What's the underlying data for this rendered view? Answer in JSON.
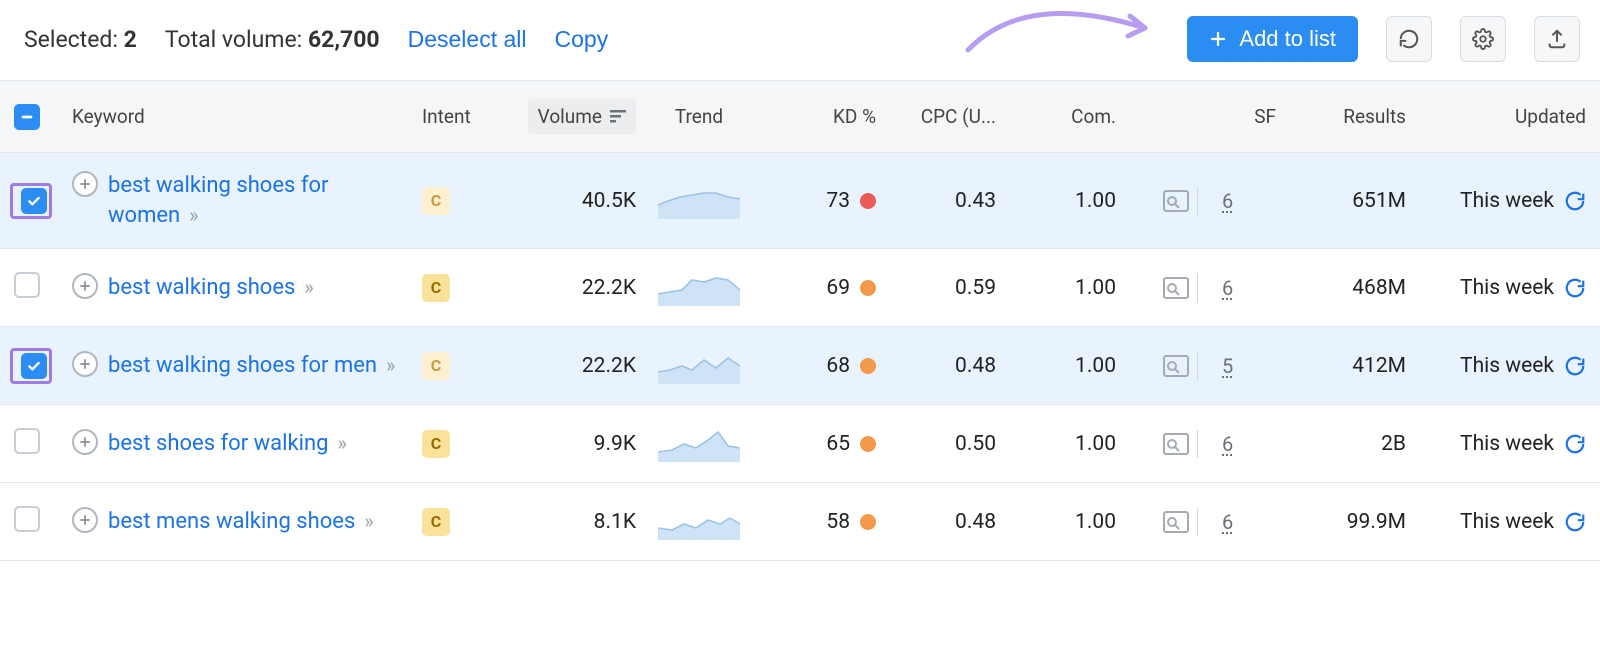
{
  "topbar": {
    "selected_label": "Selected:",
    "selected_count": "2",
    "total_volume_label": "Total volume:",
    "total_volume_value": "62,700",
    "deselect_all": "Deselect all",
    "copy": "Copy",
    "add_to_list": "Add to list"
  },
  "columns": {
    "keyword": "Keyword",
    "intent": "Intent",
    "volume": "Volume",
    "trend": "Trend",
    "kd": "KD %",
    "cpc": "CPC (U...",
    "com": "Com.",
    "sf": "SF",
    "results": "Results",
    "updated": "Updated"
  },
  "rows": [
    {
      "selected": true,
      "highlight": true,
      "keyword": "best walking shoes for women",
      "intent": "C",
      "intent_faded": true,
      "volume": "40.5K",
      "kd": "73",
      "kd_color": "red",
      "cpc": "0.43",
      "com": "1.00",
      "sf": "6",
      "results": "651M",
      "updated": "This week"
    },
    {
      "selected": false,
      "highlight": false,
      "keyword": "best walking shoes",
      "intent": "C",
      "intent_faded": false,
      "volume": "22.2K",
      "kd": "69",
      "kd_color": "orange",
      "cpc": "0.59",
      "com": "1.00",
      "sf": "6",
      "results": "468M",
      "updated": "This week"
    },
    {
      "selected": true,
      "highlight": true,
      "keyword": "best walking shoes for men",
      "intent": "C",
      "intent_faded": true,
      "volume": "22.2K",
      "kd": "68",
      "kd_color": "orange",
      "cpc": "0.48",
      "com": "1.00",
      "sf": "5",
      "results": "412M",
      "updated": "This week"
    },
    {
      "selected": false,
      "highlight": false,
      "keyword": "best shoes for walking",
      "intent": "C",
      "intent_faded": false,
      "volume": "9.9K",
      "kd": "65",
      "kd_color": "orange",
      "cpc": "0.50",
      "com": "1.00",
      "sf": "6",
      "results": "2B",
      "updated": "This week"
    },
    {
      "selected": false,
      "highlight": false,
      "keyword": "best mens walking shoes",
      "intent": "C",
      "intent_faded": false,
      "volume": "8.1K",
      "kd": "58",
      "kd_color": "orange",
      "cpc": "0.48",
      "com": "1.00",
      "sf": "6",
      "results": "99.9M",
      "updated": "This week"
    }
  ]
}
